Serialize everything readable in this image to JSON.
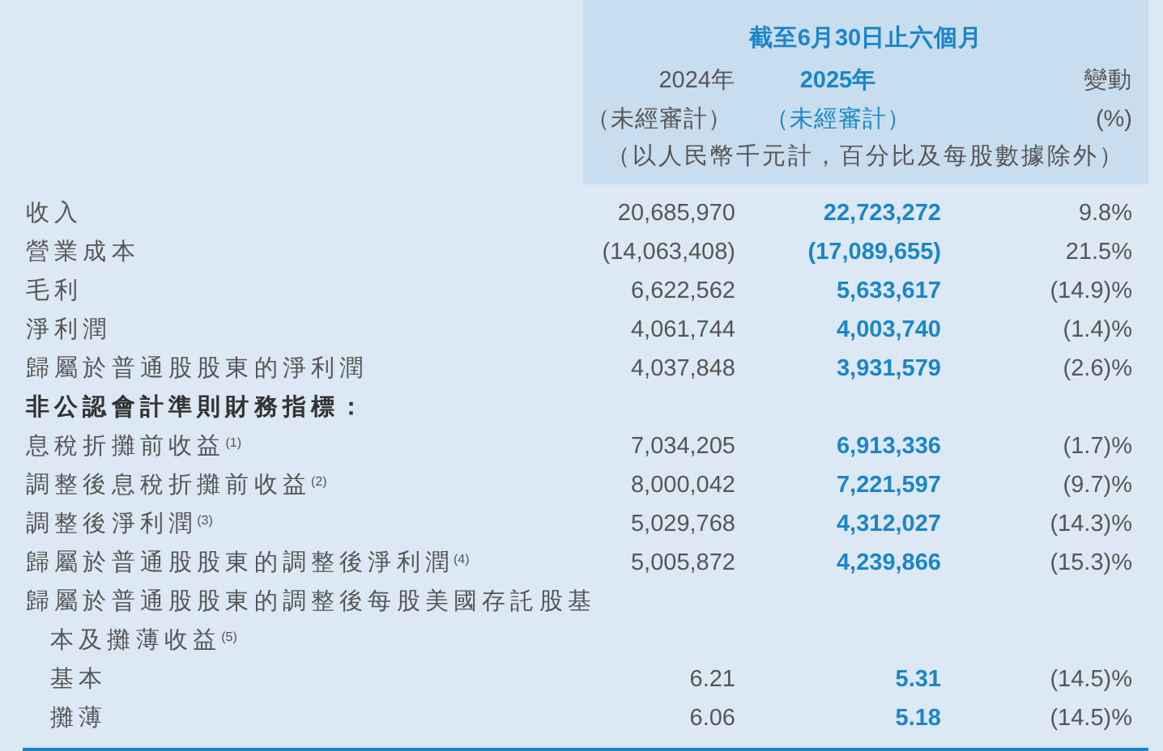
{
  "header": {
    "title": "截至6月30日止六個月",
    "columns": [
      {
        "label": "2024年",
        "note": "（未經審計）",
        "current": false
      },
      {
        "label": "2025年",
        "note": "（未經審計）",
        "current": true
      },
      {
        "label": "變動",
        "note": "(%)",
        "current": false
      }
    ],
    "unit": "（以人民幣千元計，百分比及每股數據除外）"
  },
  "rows": [
    {
      "kind": "item",
      "label": "收入",
      "values": [
        "20,685,970",
        "22,723,272",
        "9.8%"
      ]
    },
    {
      "kind": "item",
      "label": "營業成本",
      "values": [
        "(14,063,408)",
        "(17,089,655)",
        "21.5%"
      ]
    },
    {
      "kind": "item",
      "label": "毛利",
      "values": [
        "6,622,562",
        "5,633,617",
        "(14.9)%"
      ]
    },
    {
      "kind": "item",
      "label": "淨利潤",
      "values": [
        "4,061,744",
        "4,003,740",
        "(1.4)%"
      ]
    },
    {
      "kind": "item",
      "label": "歸屬於普通股股東的淨利潤",
      "values": [
        "4,037,848",
        "3,931,579",
        "(2.6)%"
      ]
    },
    {
      "kind": "section",
      "label": "非公認會計準則財務指標："
    },
    {
      "kind": "item",
      "label": "息稅折攤前收益$^{(1)}$",
      "values": [
        "7,034,205",
        "6,913,336",
        "(1.7)%"
      ]
    },
    {
      "kind": "item",
      "label": "調整後息稅折攤前收益$^{(2)}$",
      "values": [
        "8,000,042",
        "7,221,597",
        "(9.7)%"
      ]
    },
    {
      "kind": "item",
      "label": "調整後淨利潤$^{(3)}$",
      "values": [
        "5,029,768",
        "4,312,027",
        "(14.3)%"
      ]
    },
    {
      "kind": "item",
      "label": "歸屬於普通股股東的調整後淨利潤$^{(4)}$",
      "values": [
        "5,005,872",
        "4,239,866",
        "(15.3)%"
      ]
    },
    {
      "kind": "item",
      "label": "歸屬於普通股股東的調整後每股美國存託股基本及攤薄收益$^{(5)}$",
      "children": [
        {
          "kind": "item",
          "label": "基本",
          "values": [
            "6.21",
            "5.31",
            "(14.5)%"
          ]
        },
        {
          "kind": "item",
          "label": "攤薄",
          "values": [
            "6.06",
            "5.18",
            "(14.5)%"
          ]
        }
      ]
    }
  ]
}
